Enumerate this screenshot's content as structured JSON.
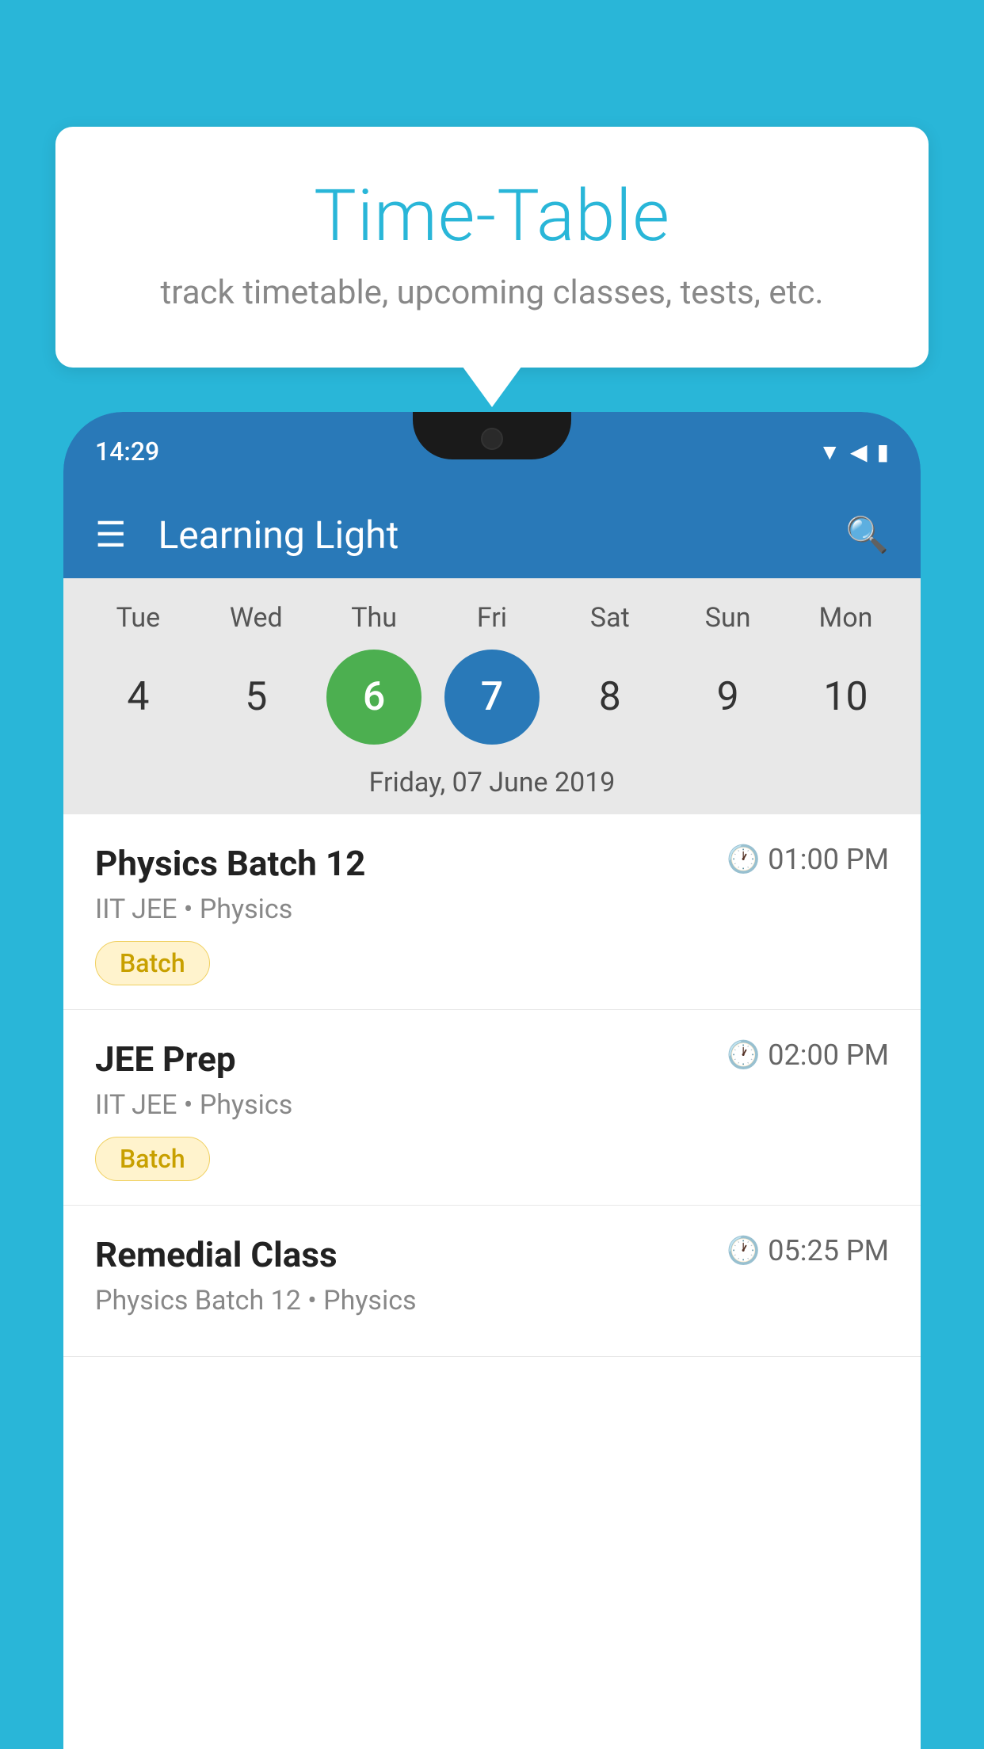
{
  "background_color": "#29b6d8",
  "speech_bubble": {
    "title": "Time-Table",
    "subtitle": "track timetable, upcoming classes, tests, etc."
  },
  "phone": {
    "status_bar": {
      "time": "14:29"
    },
    "app_header": {
      "title": "Learning Light"
    },
    "calendar": {
      "days": [
        {
          "label": "Tue",
          "number": "4",
          "state": "normal"
        },
        {
          "label": "Wed",
          "number": "5",
          "state": "normal"
        },
        {
          "label": "Thu",
          "number": "6",
          "state": "today"
        },
        {
          "label": "Fri",
          "number": "7",
          "state": "selected"
        },
        {
          "label": "Sat",
          "number": "8",
          "state": "normal"
        },
        {
          "label": "Sun",
          "number": "9",
          "state": "normal"
        },
        {
          "label": "Mon",
          "number": "10",
          "state": "normal"
        }
      ],
      "selected_date_label": "Friday, 07 June 2019"
    },
    "schedule": [
      {
        "title": "Physics Batch 12",
        "time": "01:00 PM",
        "subtitle": "IIT JEE • Physics",
        "tag": "Batch"
      },
      {
        "title": "JEE Prep",
        "time": "02:00 PM",
        "subtitle": "IIT JEE • Physics",
        "tag": "Batch"
      },
      {
        "title": "Remedial Class",
        "time": "05:25 PM",
        "subtitle": "Physics Batch 12 • Physics",
        "tag": null
      }
    ]
  }
}
